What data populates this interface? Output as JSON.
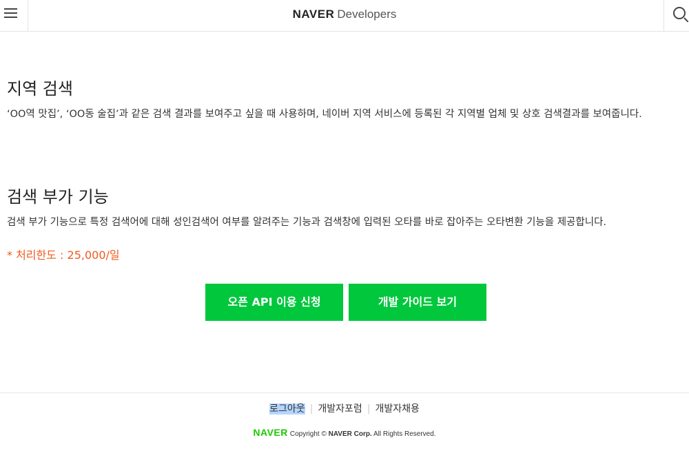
{
  "header": {
    "brand": "NAVER",
    "product": "Developers",
    "menu_icon": "hamburger-menu-icon",
    "search_icon": "search-icon"
  },
  "sections": [
    {
      "title": "지역 검색",
      "description": "‘OO역 맛집’, ‘OO동 술집’과 같은 검색 결과를 보여주고 싶을 때 사용하며, 네이버 지역 서비스에 등록된 각 지역별 업체 및 상호 검색결과를 보여줍니다."
    },
    {
      "title": "검색 부가 기능",
      "description": "검색 부가 기능으로 특정 검색어에 대해 성인검색어 여부를 알려주는 기능과 검색창에 입력된 오타를 바로 잡아주는 오타변환 기능을 제공합니다."
    }
  ],
  "limit_text": "* 처리한도 : 25,000/일",
  "buttons": {
    "apply": "오픈 API 이용 신청",
    "guide": "개발 가이드 보기"
  },
  "footer": {
    "links": [
      "로그아웃",
      "개발자포럼",
      "개발자채용"
    ],
    "copyright_brand": "NAVER",
    "copyright_prefix": "Copyright © ",
    "copyright_corp": "NAVER Corp.",
    "copyright_suffix": " All Rights Reserved."
  },
  "colors": {
    "accent_green": "#00c73c",
    "limit_orange": "#f05a1e"
  }
}
